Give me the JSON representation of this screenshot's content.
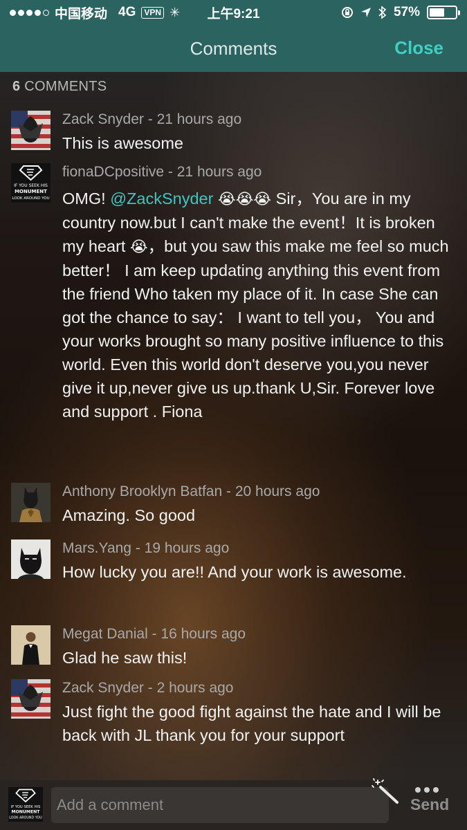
{
  "status_bar": {
    "carrier": "中国移动",
    "network": "4G",
    "vpn": "VPN",
    "time": "上午9:21",
    "battery_percent_text": "57%",
    "battery_level": 0.57
  },
  "nav": {
    "title": "Comments",
    "close_label": "Close"
  },
  "comments_header": {
    "count": "6",
    "label": "COMMENTS"
  },
  "comments": [
    {
      "author": "Zack Snyder",
      "time": "21 hours ago",
      "text": "This is awesome"
    },
    {
      "author": "fionaDCpositive",
      "time": "21 hours ago",
      "text_prefix": "OMG!  ",
      "mention": "@ZackSnyder",
      "text_emoji_1": "😭😭😭",
      "text_mid": " Sir，You are in my country now.but I can't make the event！It is broken my heart ",
      "text_emoji_2": "😭",
      "text_rest": "，but you saw this make me feel so much better！ I am keep updating anything this event from the friend Who taken my place of it. In case She can got the chance to say： I want to tell you， You and your works brought so many positive influence to this world. Even this world don't deserve you,you never give it up,never give us up.thank U,Sir. Forever love and support . Fiona"
    },
    {
      "author": "Anthony Brooklyn Batfan",
      "time": "20 hours ago",
      "text": "Amazing. So good"
    },
    {
      "author": "Mars.Yang",
      "time": "19 hours ago",
      "text": "How lucky you are!! And your work is awesome."
    },
    {
      "author": "Megat Danial",
      "time": "16 hours ago",
      "text": "Glad he saw this!"
    },
    {
      "author": "Zack Snyder",
      "time": "2 hours ago",
      "text": "Just fight the good fight against the hate and I will be back with JL thank you for your support"
    }
  ],
  "avatar_text": {
    "line1": "IF YOU SEEK HIS",
    "line2": "MONUMENT",
    "line3": "LOOK AROUND YOU"
  },
  "composer": {
    "placeholder": "Add a comment",
    "send_label": "Send"
  },
  "colors": {
    "header_bg": "#2b6360",
    "accent": "#3fd0c4",
    "mention": "#3fc6c0"
  },
  "icons": [
    "signal-icon",
    "spinner-icon",
    "lock-rotation-icon",
    "location-arrow-icon",
    "bluetooth-icon",
    "battery-icon",
    "magic-wand-icon",
    "more-dots-icon"
  ]
}
